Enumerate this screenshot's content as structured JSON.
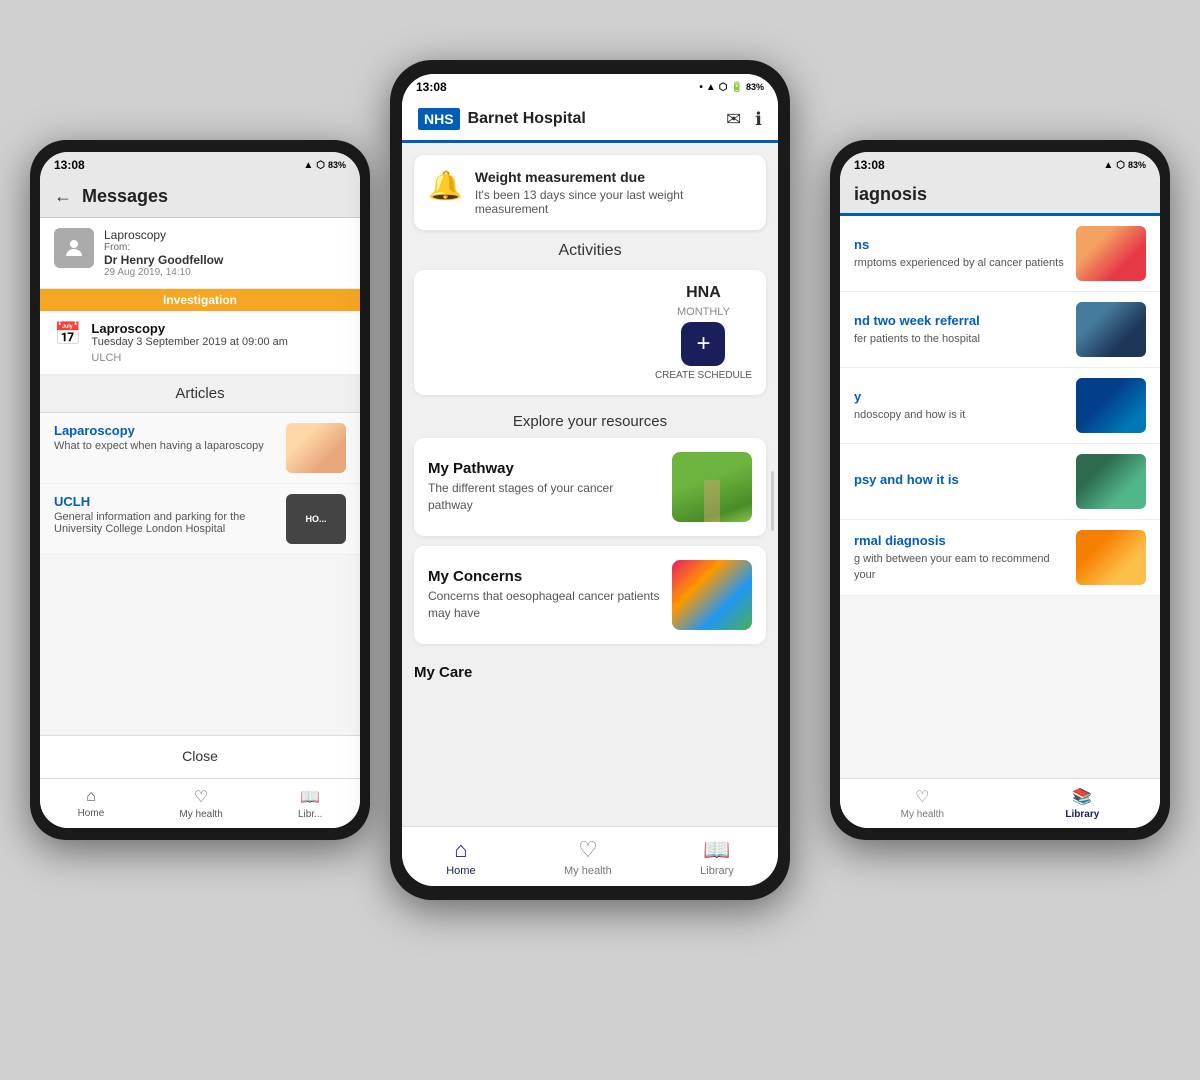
{
  "leftPhone": {
    "statusBar": {
      "time": "13:08",
      "battery": "83%"
    },
    "header": {
      "backLabel": "←",
      "title": "Messages"
    },
    "message": {
      "title": "Laproscopy",
      "from": "From:",
      "sender": "Dr Henry  Goodfellow",
      "date": "29 Aug 2019, 14:10"
    },
    "badge": "Investigation",
    "appointment": {
      "title": "Laproscopy",
      "date": "Tuesday 3 September 2019 at 09:00 am",
      "location": "ULCH"
    },
    "articlesHeading": "Articles",
    "articles": [
      {
        "title": "Laparoscopy",
        "desc": "What to expect when having a laparoscopy"
      },
      {
        "title": "UCLH",
        "desc": "General information and parking for the University College London Hospital"
      }
    ],
    "closeBtn": "Close",
    "bottomNav": [
      {
        "label": "Home",
        "icon": "⌂"
      },
      {
        "label": "My health",
        "icon": "♡"
      },
      {
        "label": "Libr...",
        "icon": "📖"
      }
    ]
  },
  "centerPhone": {
    "statusBar": {
      "time": "13:08",
      "battery": "83%"
    },
    "header": {
      "nhsLogo": "NHS",
      "hospitalName": "Barnet Hospital",
      "mailIcon": "✉",
      "infoIcon": "ℹ"
    },
    "alert": {
      "icon": "🔔",
      "title": "Weight measurement due",
      "desc": "It's been 13 days since your last weight measurement"
    },
    "activitiesHeading": "Activities",
    "hna": {
      "label": "HNA",
      "monthly": "MONTHLY",
      "plusIcon": "+",
      "createLabel": "CREATE SCHEDULE"
    },
    "exploreHeading": "Explore your resources",
    "resources": [
      {
        "title": "My Pathway",
        "desc": "The different stages of your cancer pathway",
        "imgType": "pathway"
      },
      {
        "title": "My Concerns",
        "desc": "Concerns that oesophageal cancer patients may have",
        "imgType": "concerns"
      }
    ],
    "myCarePartial": "My Care",
    "bottomNav": [
      {
        "label": "Home",
        "icon": "⌂",
        "active": true
      },
      {
        "label": "My health",
        "icon": "♡",
        "active": false
      },
      {
        "label": "Library",
        "icon": "📖",
        "active": false
      }
    ]
  },
  "rightPhone": {
    "statusBar": {
      "battery": "83%"
    },
    "header": {
      "titlePartial": "iagnosis"
    },
    "items": [
      {
        "title": "ns",
        "desc": "rmptoms experienced by al cancer patients",
        "imgType": "throat"
      },
      {
        "title": "nd two week referral",
        "desc": "fer patients to the hospital",
        "imgType": "doctor"
      },
      {
        "title": "y",
        "desc": "ndoscopy and how is it",
        "imgType": "scope"
      },
      {
        "title": "psy and how it is",
        "desc": "",
        "imgType": "lab"
      },
      {
        "title": "rmal diagnosis",
        "desc": "g with between your eam to recommend your",
        "imgType": "team"
      }
    ],
    "bottomNav": [
      {
        "label": "My health",
        "icon": "♡",
        "active": false
      },
      {
        "label": "Library",
        "icon": "📖",
        "active": true
      }
    ]
  }
}
